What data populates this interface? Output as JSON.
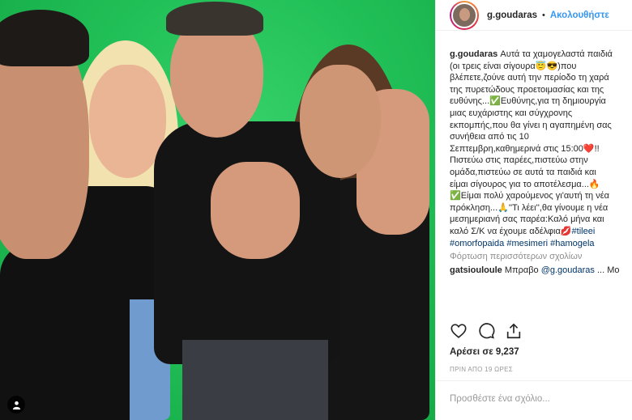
{
  "header": {
    "username": "g.goudaras",
    "separator": "•",
    "follow_label": "Ακολουθήστε"
  },
  "caption": {
    "username": "g.goudaras",
    "lines": [
      "Αυτά τα χαμογελαστά παιδιά",
      "(οι τρεις είναι σίγουρα😇😎)που",
      "βλέπετε,ζούνε αυτή την περίοδο τη χαρά",
      "της πυρετώδους προετοιμασίας και της",
      "ευθύνης...✅Ευθύνης,για τη δημιουργία",
      "μιας ευχάριστης και σύγχρονης",
      "εκπομπής,που θα γίνει η αγαπημένη σας",
      "συνήθεια από τις 10",
      "Σεπτεμβρη,καθημερινά στις 15:00❤️!!",
      "Πιστεύω στις παρέες,πιστεύω στην",
      "ομάδα,πιστεύω σε αυτά τα παιδιά και",
      "είμαι σίγουρος για το αποτέλεσμα...🔥",
      "✅Είμαι πολύ χαρούμενος γι'αυτή τη νέα",
      "πρόκληση...🙏''Τι λέει'',θα γίνουμε η νέα",
      "μεσημεριανή σας παρέα:Καλό μήνα και",
      "καλό Σ/Κ να έχουμε αδέλφια💋"
    ],
    "tags_line1": "#tileei",
    "tags_line2": "#omorfopaida #mesimeri #hamogela"
  },
  "load_more": "Φόρτωση περισσότερων σχολίων",
  "comment": {
    "username": "gatsiouloule",
    "text_before": "Μπραβο ",
    "mention": "@g.goudaras",
    "text_after": " ... Μο"
  },
  "icons": [
    "heart-icon",
    "comment-icon",
    "share-icon",
    "user-tag-icon"
  ],
  "likes": "Αρέσει σε 9,237",
  "timestamp": "ΠΡΙΝ ΑΠΟ 19 ΩΡΕΣ",
  "add_comment": {
    "placeholder": "Προσθέστε ένα σχόλιο..."
  }
}
